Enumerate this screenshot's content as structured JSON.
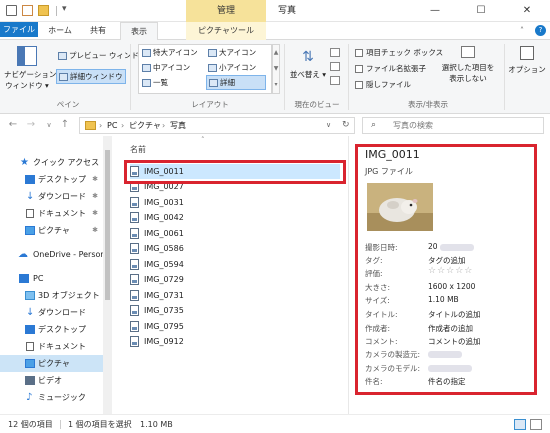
{
  "window": {
    "context_tab_group": "管理",
    "title": "写真"
  },
  "ribbon_tabs": [
    "ファイル",
    "ホーム",
    "共有",
    "表示",
    "ピクチャツール"
  ],
  "ribbon": {
    "pane_group": {
      "nav_pane": "ナビゲーション",
      "nav_pane_2": "ウィンドウ",
      "preview": "プレビュー ウィンドウ",
      "details": "詳細ウィンドウ",
      "label": "ペイン"
    },
    "layout_group": {
      "items": [
        "特大アイコン",
        "大アイコン",
        "中アイコン",
        "小アイコン",
        "一覧",
        "詳細"
      ],
      "label": "レイアウト"
    },
    "current_view_group": {
      "sort": "並べ替え",
      "label": "現在のビュー"
    },
    "show_hide_group": {
      "checkboxes": [
        "項目チェック ボックス",
        "ファイル名拡張子",
        "隠しファイル"
      ],
      "hide_selected": "選択した項目を",
      "hide_selected_2": "表示しない",
      "label": "表示/非表示"
    },
    "options": "オプション"
  },
  "address": {
    "crumbs": [
      "PC",
      "ピクチャ",
      "写真"
    ],
    "search_placeholder": "写真の検索"
  },
  "nav_pane": {
    "items": [
      {
        "label": "クイック アクセス",
        "icon": "star-icon"
      },
      {
        "label": "デスクトップ",
        "icon": "desktop-icon"
      },
      {
        "label": "ダウンロード",
        "icon": "download-icon"
      },
      {
        "label": "ドキュメント",
        "icon": "document-icon"
      },
      {
        "label": "ピクチャ",
        "icon": "pictures-icon"
      },
      {
        "label": "OneDrive - Persor",
        "icon": "cloud-icon"
      },
      {
        "label": "PC",
        "icon": "pc-icon"
      },
      {
        "label": "3D オブジェクト",
        "icon": "cube-icon"
      },
      {
        "label": "ダウンロード",
        "icon": "download-icon"
      },
      {
        "label": "デスクトップ",
        "icon": "desktop-icon"
      },
      {
        "label": "ドキュメント",
        "icon": "document-icon"
      },
      {
        "label": "ピクチャ",
        "icon": "pictures-icon"
      },
      {
        "label": "ビデオ",
        "icon": "video-icon"
      },
      {
        "label": "ミュージック",
        "icon": "music-icon"
      }
    ]
  },
  "file_list": {
    "column_header": "名前",
    "files": [
      "IMG_0011",
      "IMG_0027",
      "IMG_0031",
      "IMG_0042",
      "IMG_0061",
      "IMG_0586",
      "IMG_0594",
      "IMG_0729",
      "IMG_0731",
      "IMG_0735",
      "IMG_0795",
      "IMG_0912"
    ],
    "selected": "IMG_0011"
  },
  "details": {
    "name": "IMG_0011",
    "type": "JPG ファイル",
    "properties": [
      {
        "label": "撮影日時:",
        "value": "20"
      },
      {
        "label": "タグ:",
        "value": "タグの追加"
      },
      {
        "label": "評価:",
        "value": "☆☆☆☆☆"
      },
      {
        "label": "大きさ:",
        "value": "1600 x 1200"
      },
      {
        "label": "サイズ:",
        "value": "1.10 MB"
      },
      {
        "label": "タイトル:",
        "value": "タイトルの追加"
      },
      {
        "label": "作成者:",
        "value": "作成者の追加"
      },
      {
        "label": "コメント:",
        "value": "コメントの追加"
      },
      {
        "label": "カメラの製造元:",
        "value": ""
      },
      {
        "label": "カメラのモデル:",
        "value": ""
      },
      {
        "label": "件名:",
        "value": "件名の指定"
      }
    ]
  },
  "status": {
    "count": "12 個の項目",
    "selection": "1 個の項目を選択",
    "size": "1.10 MB"
  },
  "colors": {
    "file_tab": "#1979ca",
    "highlight_box": "#d9242f",
    "selection": "#cce8ff",
    "context_tab": "#f6e29a"
  }
}
